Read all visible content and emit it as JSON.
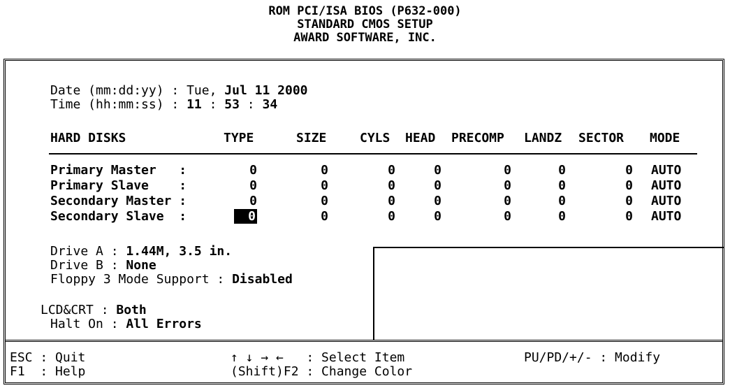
{
  "header": {
    "line1": "ROM PCI/ISA BIOS (P632-000)",
    "line2": "STANDARD CMOS SETUP",
    "line3": "AWARD SOFTWARE, INC."
  },
  "date": {
    "label": "Date (mm:dd:yy) : ",
    "day": "Tue,",
    "value": "Jul 11 2000"
  },
  "time": {
    "label": "Time (hh:mm:ss) : ",
    "hh": "11",
    "sep1": " : ",
    "mm": "53",
    "sep2": " : ",
    "ss": "34"
  },
  "hdd": {
    "columns": [
      "HARD DISKS",
      "TYPE",
      "SIZE",
      "CYLS",
      "HEAD",
      "PRECOMP",
      "LANDZ",
      "SECTOR",
      "MODE"
    ],
    "rows": [
      {
        "name": "Primary Master   :",
        "type": "0",
        "size": "0",
        "cyls": "0",
        "head": "0",
        "precomp": "0",
        "landz": "0",
        "sector": "0",
        "mode": "AUTO"
      },
      {
        "name": "Primary Slave    :",
        "type": "0",
        "size": "0",
        "cyls": "0",
        "head": "0",
        "precomp": "0",
        "landz": "0",
        "sector": "0",
        "mode": "AUTO"
      },
      {
        "name": "Secondary Master :",
        "type": "0",
        "size": "0",
        "cyls": "0",
        "head": "0",
        "precomp": "0",
        "landz": "0",
        "sector": "0",
        "mode": "AUTO"
      },
      {
        "name": "Secondary Slave  :",
        "type": "0",
        "size": "0",
        "cyls": "0",
        "head": "0",
        "precomp": "0",
        "landz": "0",
        "sector": "0",
        "mode": "AUTO"
      }
    ]
  },
  "drives": {
    "a_label": "Drive A : ",
    "a_value": "1.44M, 3.5 in.",
    "b_label": "Drive B : ",
    "b_value": "None",
    "floppy3_label": "Floppy 3 Mode Support : ",
    "floppy3_value": "Disabled"
  },
  "display": {
    "lcd_label": "LCD&CRT : ",
    "lcd_value": "Both",
    "halt_label": "Halt On : ",
    "halt_value": "All Errors"
  },
  "footer": {
    "esc": "ESC : Quit",
    "f1": "F1  : Help",
    "arrows": "↑ ↓ → ←   : Select Item",
    "shift_f2": "(Shift)F2 : Change Color",
    "modify": "PU/PD/+/- : Modify"
  }
}
